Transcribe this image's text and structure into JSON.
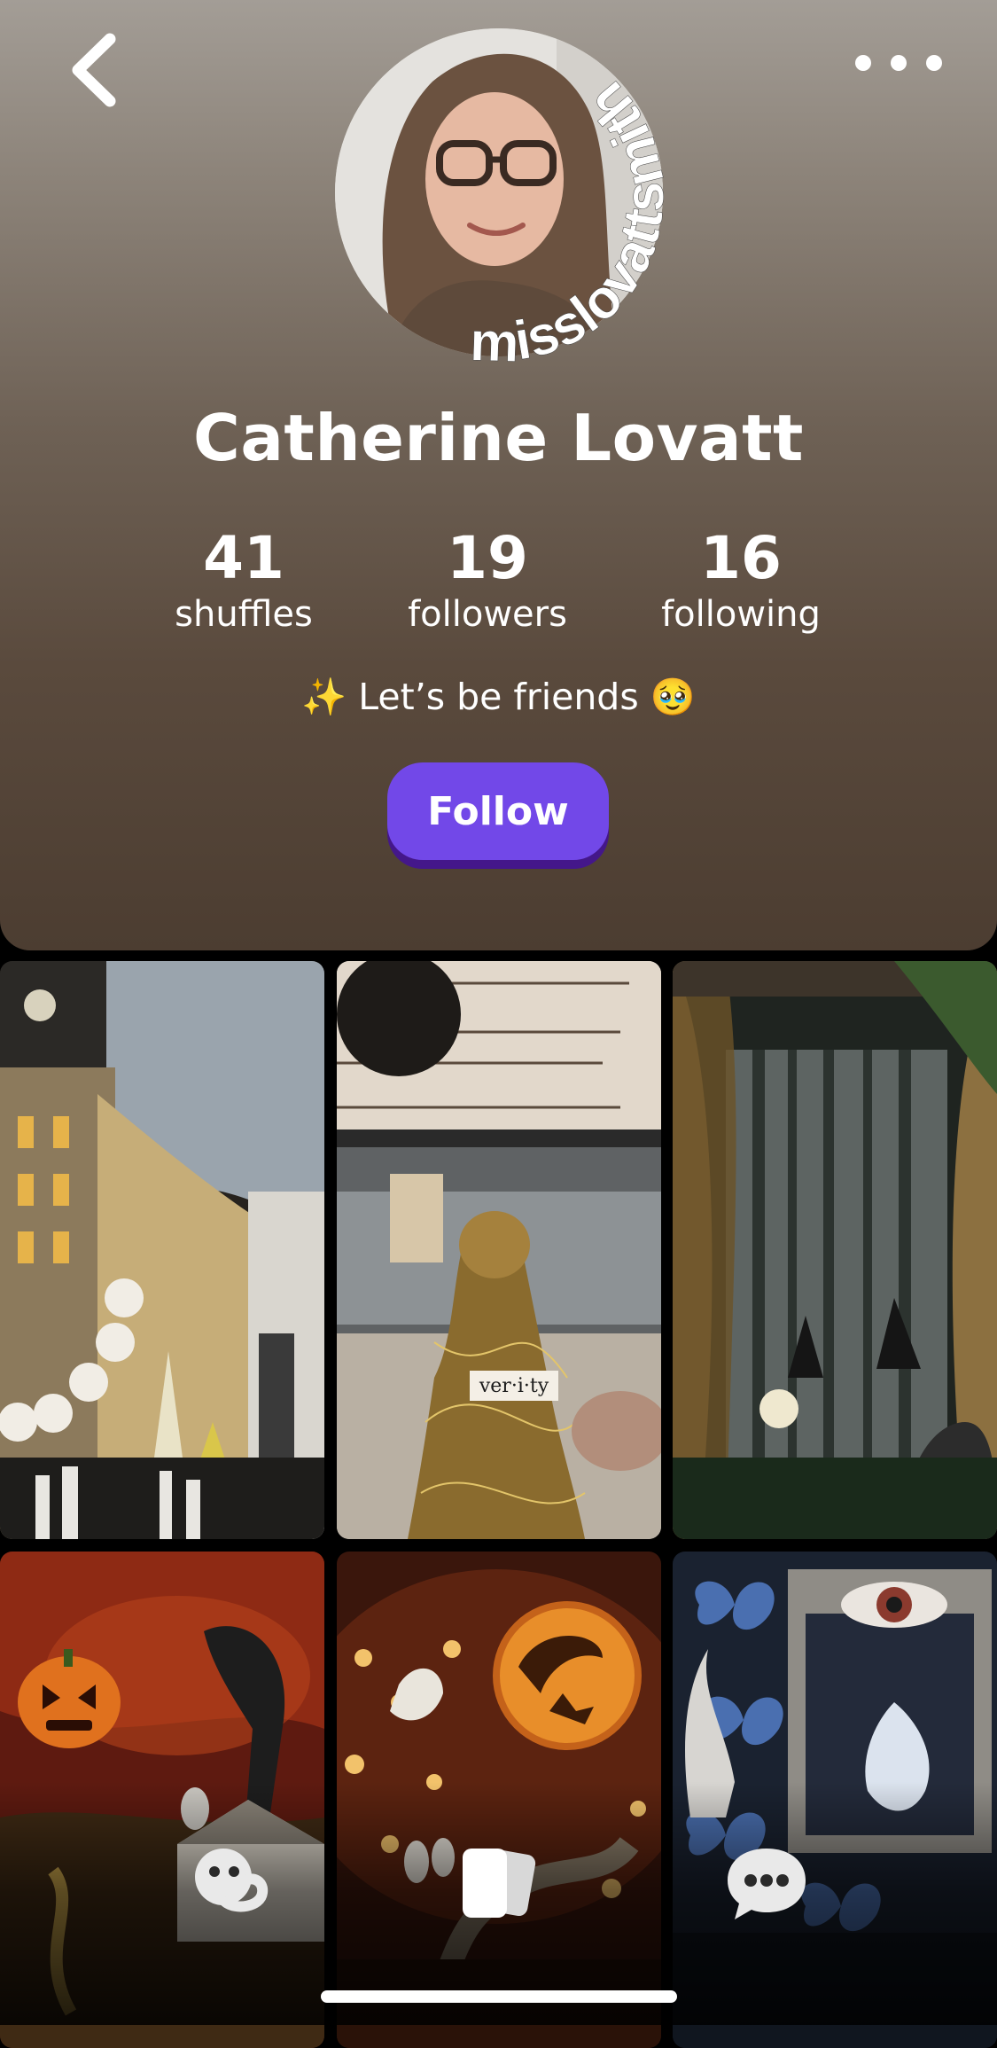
{
  "profile": {
    "username": "misslovattsmith",
    "display_name": "Catherine Lovatt",
    "bio": "✨ Let’s be friends 🥹"
  },
  "stats": [
    {
      "value": "41",
      "label": "shuffles"
    },
    {
      "value": "19",
      "label": "followers"
    },
    {
      "value": "16",
      "label": "following"
    }
  ],
  "actions": {
    "follow_label": "Follow",
    "back_icon": "chevron-left-icon",
    "more_icon": "more-horizontal-icon"
  },
  "grid": {
    "tiles": [
      {
        "caption": ""
      },
      {
        "caption": "ver·i·ty"
      },
      {
        "caption": ""
      },
      {
        "caption": ""
      },
      {
        "caption": ""
      },
      {
        "caption": ""
      }
    ]
  },
  "tabbar": {
    "items": [
      {
        "icon": "smiley-face-icon"
      },
      {
        "icon": "shuffle-cards-icon"
      },
      {
        "icon": "chat-bubble-icon"
      }
    ]
  },
  "colors": {
    "follow_button": "#7248e8",
    "follow_shadow": "#44178a"
  }
}
